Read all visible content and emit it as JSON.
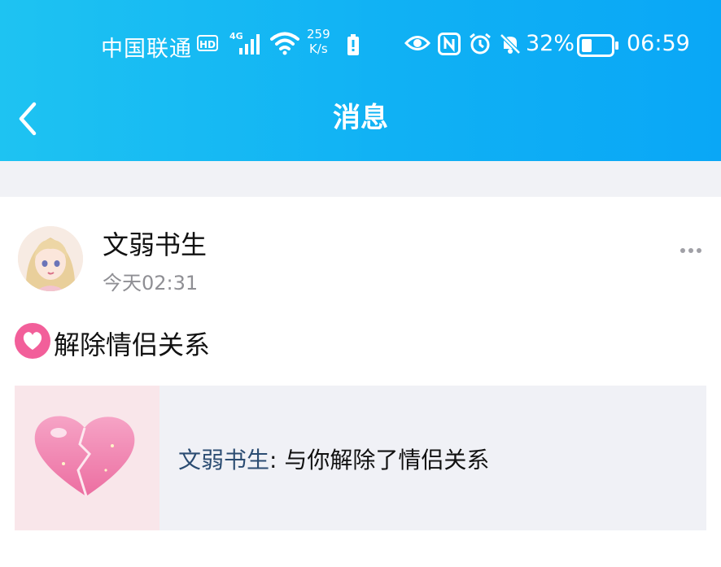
{
  "status_bar": {
    "carrier": "中国联通",
    "hd_badge": "HD",
    "network": "4G",
    "speed_value": "259",
    "speed_unit": "K/s",
    "battery_percent": "32%",
    "time": "06:59",
    "icons": [
      "signal-icon",
      "wifi-icon",
      "battery-warning-icon",
      "eye-icon",
      "nfc-icon",
      "alarm-icon",
      "mute-icon",
      "battery-icon"
    ]
  },
  "header": {
    "title": "消息",
    "back_icon": "chevron-left-icon",
    "background_gradient": [
      "#1ec3f2",
      "#0aa7f6"
    ]
  },
  "message": {
    "sender_name": "文弱书生",
    "timestamp": "今天02:31",
    "more_icon": "more-dots-icon",
    "badge_icon": "heart-icon",
    "headline": "解除情侣关系",
    "notice": {
      "thumbnail_icon": "broken-heart-icon",
      "name": "文弱书生",
      "separator": ": ",
      "text": "与你解除了情侣关系"
    }
  },
  "colors": {
    "header_accent": "#10b1f4",
    "name_link": "#2b4c72",
    "heart_badge": "#f25f9a",
    "muted_text": "#8f8f94"
  }
}
